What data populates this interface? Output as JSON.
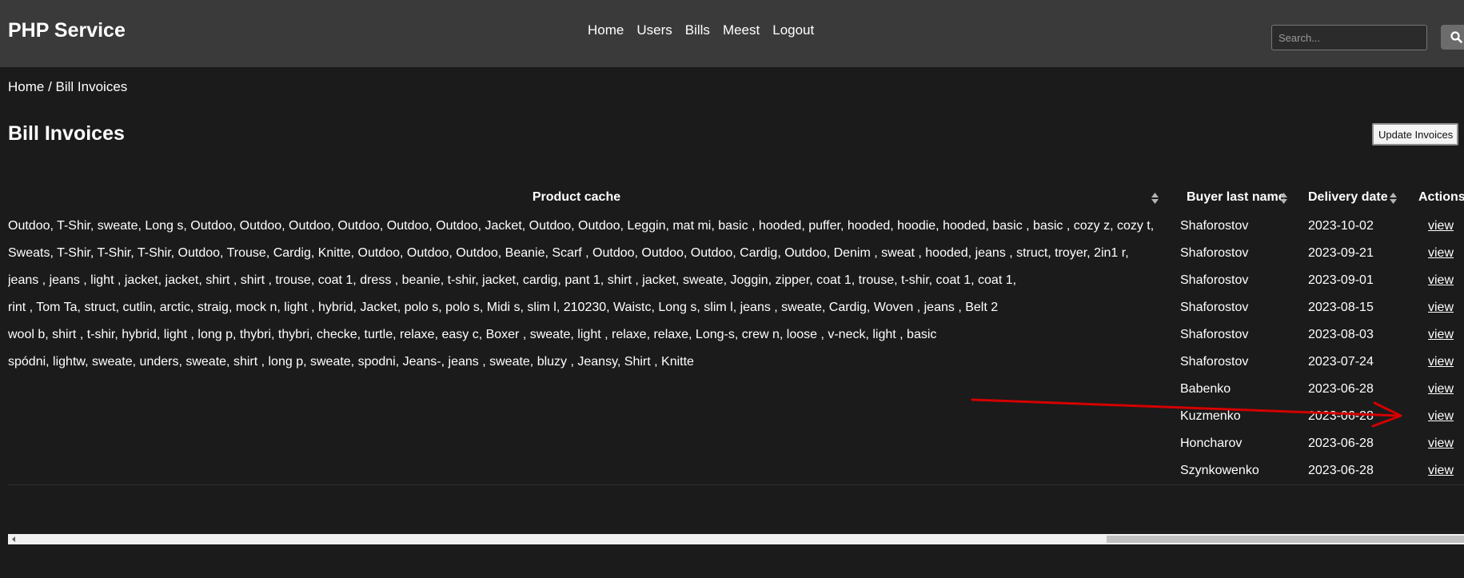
{
  "app": {
    "brand": "PHP Service"
  },
  "nav": {
    "items": [
      "Home",
      "Users",
      "Bills",
      "Meest",
      "Logout"
    ]
  },
  "search": {
    "placeholder": "Search...",
    "icon": "search-icon"
  },
  "breadcrumb": "Home / Bill Invoices",
  "page": {
    "title": "Bill Invoices",
    "update_label": "Update Invoices"
  },
  "table": {
    "columns": [
      "Product cache",
      "Buyer last name",
      "Delivery date",
      "Actions"
    ],
    "rows": [
      {
        "product": "Outdoo, T-Shir, sweate, Long s, Outdoo, Outdoo, Outdoo, Outdoo, Outdoo, Outdoo, Jacket, Outdoo, Outdoo, Leggin, mat mi, basic , hooded, puffer, hooded, hoodie, hooded, basic , basic , cozy z, cozy t,",
        "buyer": "Shaforostov",
        "date": "2023-10-02",
        "action": "view"
      },
      {
        "product": "Sweats, T-Shir, T-Shir, T-Shir, Outdoo, Trouse, Cardig, Knitte, Outdoo, Outdoo, Outdoo, Beanie, Scarf , Outdoo, Outdoo, Outdoo, Cardig, Outdoo, Denim , sweat , hooded, jeans , struct, troyer, 2in1 r,",
        "buyer": "Shaforostov",
        "date": "2023-09-21",
        "action": "view"
      },
      {
        "product": "jeans , jeans , light , jacket, jacket, shirt , shirt , trouse, coat 1, dress , beanie, t-shir, jacket, cardig, pant 1, shirt , jacket, sweate, Joggin, zipper, coat 1, trouse, t-shir, coat 1, coat 1,",
        "buyer": "Shaforostov",
        "date": "2023-09-01",
        "action": "view"
      },
      {
        "product": "rint , Tom Ta, struct, cutlin, arctic, straig, mock n, light , hybrid, Jacket, polo s, polo s, Midi s, slim l, 210230, Waistc, Long s, slim l, jeans , sweate, Cardig, Woven , jeans , Belt 2",
        "buyer": "Shaforostov",
        "date": "2023-08-15",
        "action": "view"
      },
      {
        "product": "wool b, shirt , t-shir, hybrid, light , long p, thybri, thybri, checke, turtle, relaxe, easy c, Boxer , sweate, light , relaxe, relaxe, Long-s, crew n, loose , v-neck, light , basic",
        "buyer": "Shaforostov",
        "date": "2023-08-03",
        "action": "view"
      },
      {
        "product": "spódni, lightw, sweate, unders, sweate, shirt , long p, sweate, spodni, Jeans-, jeans , sweate, bluzy , Jeansy, Shirt , Knitte",
        "buyer": "Shaforostov",
        "date": "2023-07-24",
        "action": "view"
      },
      {
        "product": "",
        "buyer": "Babenko",
        "date": "2023-06-28",
        "action": "view"
      },
      {
        "product": "",
        "buyer": "Kuzmenko",
        "date": "2023-06-28",
        "action": "view"
      },
      {
        "product": "",
        "buyer": "Honcharov",
        "date": "2023-06-28",
        "action": "view"
      },
      {
        "product": "",
        "buyer": "Szynkowenko",
        "date": "2023-06-28",
        "action": "view"
      }
    ]
  },
  "colors": {
    "topbar": "#3a3a3a",
    "background": "#1b1b1b",
    "annotation_arrow": "#d40000"
  }
}
